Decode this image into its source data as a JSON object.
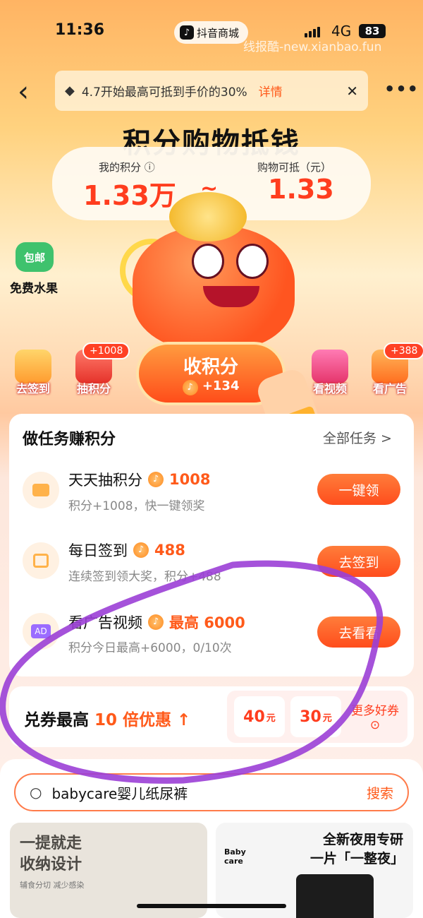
{
  "status": {
    "time": "11:36",
    "app_name": "抖音商城",
    "network": "4G",
    "battery": "83",
    "watermark": "线报酷-new.xianbao.fun"
  },
  "notice": {
    "text": "4.7开始最高可抵到手价的30%",
    "detail": "详情"
  },
  "hero": {
    "title": "积分购物抵钱",
    "my_points_label": "我的积分",
    "my_points_value": "1.33万",
    "deduct_label": "购物可抵（元）",
    "deduct_value": "1.33",
    "tilde": "~"
  },
  "side": {
    "badge": "包邮",
    "label": "免费水果"
  },
  "quick": [
    {
      "label": "去签到"
    },
    {
      "label": "抽积分",
      "badge": "+1008"
    },
    {
      "label": "看视频"
    },
    {
      "label": "看广告",
      "badge": "+388"
    }
  ],
  "collect": {
    "label": "收积分",
    "amount": "+134"
  },
  "tasks": {
    "title": "做任务赚积分",
    "all": "全部任务 >",
    "items": [
      {
        "name": "天天抽积分",
        "points": "1008",
        "sub": "积分+1008，快一键领奖",
        "button": "一键领",
        "icon": "lottery-icon"
      },
      {
        "name": "每日签到",
        "points": "488",
        "sub": "连续签到领大奖，积分+488",
        "button": "去签到",
        "icon": "calendar-icon"
      },
      {
        "name": "看广告视频",
        "points": "最高 6000",
        "sub": "积分今日最高+6000，0/10次",
        "button": "去看看",
        "icon": "ad-icon"
      }
    ]
  },
  "coupon": {
    "title_a": "兑券最高 ",
    "title_b": "10 倍优惠",
    "chips": [
      {
        "value": "40",
        "unit": "元"
      },
      {
        "value": "30",
        "unit": "元"
      }
    ],
    "more": "更多好券"
  },
  "search": {
    "query": "babycare婴儿纸尿裤",
    "button": "搜索"
  },
  "products": [
    {
      "title": "一提就走\n收纳设计",
      "sub": "辅食分切  减少感染"
    },
    {
      "title": "全新夜用专研\n一片「一整夜」",
      "brand": "Baby care"
    }
  ],
  "colors": {
    "accent": "#ff5a1a",
    "scribble": "#9b3fd6"
  }
}
